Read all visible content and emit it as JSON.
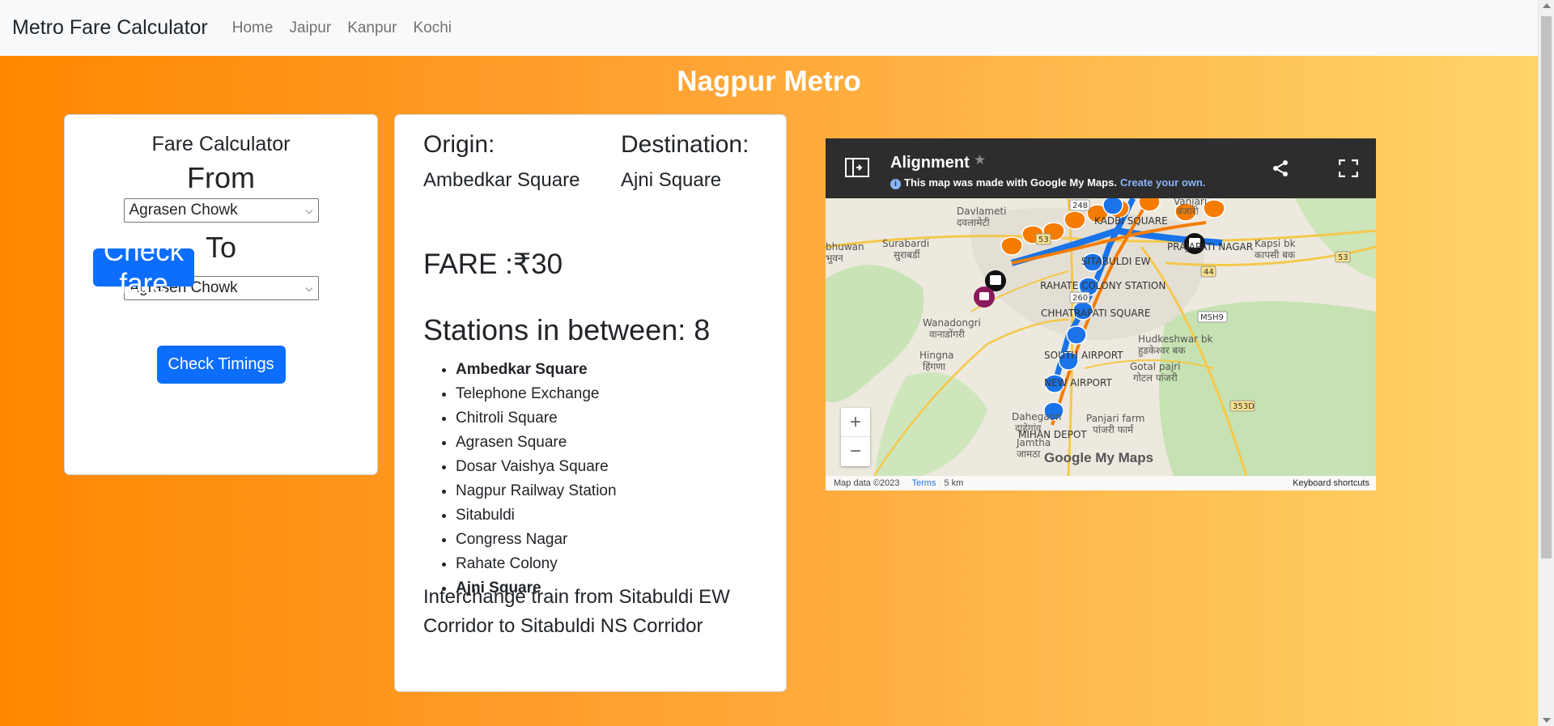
{
  "navbar": {
    "brand": "Metro Fare Calculator",
    "links": [
      "Home",
      "Jaipur",
      "Kanpur",
      "Kochi"
    ]
  },
  "page": {
    "title": "Nagpur Metro"
  },
  "calculator": {
    "title": "Fare Calculator",
    "from_label": "From",
    "from_value": "Agrasen Chowk",
    "to_label": "To",
    "to_value": "Agrasen Chowk",
    "check_fare": "Check fare",
    "check_timings": "Check Timings"
  },
  "route": {
    "origin_label": "Origin:",
    "origin_value": "Ambedkar Square",
    "destination_label": "Destination:",
    "destination_value": "Ajni Square",
    "fare": "FARE :₹30",
    "stations_heading": "Stations in between: 8",
    "stations": [
      "Ambedkar Square",
      "Telephone Exchange",
      "Chitroli Square",
      "Agrasen Square",
      "Dosar Vaishya Square",
      "Nagpur Railway Station",
      "Sitabuldi",
      "Congress Nagar",
      "Rahate Colony",
      "Ajni Square"
    ],
    "interchange": "Interchange train from Sitabuldi EW Corridor to Sitabuldi NS Corridor"
  },
  "map": {
    "title": "Alignment",
    "made_with": "This map was made with Google My Maps.",
    "create_link": "Create your own.",
    "labels": [
      "Davlameti",
      "दवलामेटी",
      "Surabardi",
      "सुराबर्डी",
      "bhuwan",
      "भुवन",
      "Wanadongri",
      "वानाडोंगरी",
      "Hingna",
      "हिंगणा",
      "KADBI SQUARE",
      "SITABULDI EW",
      "RAHATE COLONY STATION",
      "CHHATRAPATI SQUARE",
      "PRAJAPATI NAGAR",
      "SOUTH AIRPORT",
      "NEW AIRPORT",
      "MIHAN DEPOT",
      "Dahegaon",
      "दाहेगांव",
      "Panjari farm",
      "पांजरी फार्म",
      "Gotal pajri",
      "गोटल पांजरी",
      "Hudkeshwar bk",
      "हुडकेश्वर बक",
      "Kapsi bk",
      "कापसी बक",
      "Vanjari",
      "वंजारी",
      "Jamtha",
      "जामठा"
    ],
    "roads": [
      "248",
      "53",
      "260",
      "44",
      "MSH9",
      "353D",
      "53"
    ],
    "footer_data": "Map data ©2023",
    "footer_terms": "Terms",
    "footer_scale": "5 km",
    "footer_keyboard": "Keyboard shortcuts",
    "brand": "Google My Maps",
    "zoom_in": "+",
    "zoom_out": "−"
  },
  "colors": {
    "accent": "#0d6efd",
    "metro_orange": "#f57c00",
    "metro_blue": "#1a73e8"
  }
}
